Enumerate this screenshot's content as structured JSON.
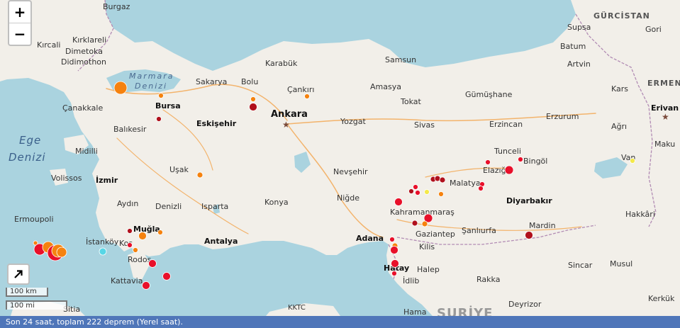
{
  "map": {
    "zoom_in_label": "+",
    "zoom_out_label": "−",
    "scale_km": "100 km",
    "scale_mi": "100 mi",
    "status_text": "Son 24 saat, toplam 222 deprem (Yerel saat).",
    "colors": {
      "sea": "#aad3df",
      "land": "#f2efe9",
      "quake_red": "#e8102a",
      "quake_darkred": "#b0101c",
      "quake_orange": "#f5820f",
      "quake_yellow": "#f4e94a",
      "quake_cyan": "#58d6e6",
      "status_bar": "#4f76b9"
    },
    "labels": {
      "burgaz": "Burgaz",
      "gurcistan": "GÜRCİSTAN",
      "kirklareli": "Kırklareli",
      "kircali": "Kırcali",
      "dimetoka": "Dimetoka",
      "didimothon": "Didimothon",
      "marmara": "Marmara",
      "denizi_m": "Denizi",
      "sakarya": "Sakarya",
      "bolu": "Bolu",
      "karabuk": "Karabük",
      "samsun": "Samsun",
      "supsa": "Supsa",
      "gori": "Gori",
      "batum": "Batum",
      "artvin": "Artvin",
      "kars": "Kars",
      "ermenistan": "ERMENİS",
      "canakkale": "Çanakkale",
      "bursa": "Bursa",
      "cankiri": "Çankırı",
      "amasya": "Amasya",
      "gumushane": "Gümüşhane",
      "tokat": "Tokat",
      "erzurum": "Erzurum",
      "erivan": "Erivan",
      "ege": "Ege",
      "denizi_e": "Denizi",
      "balikesir": "Balıkesir",
      "eskisehir": "Eskişehir",
      "ankara": "Ankara",
      "yozgat": "Yozgat",
      "sivas": "Sivas",
      "erzincan": "Erzincan",
      "agri": "Ağrı",
      "midilli": "Midilli",
      "tunceli": "Tunceli",
      "bingol": "Bingöl",
      "maku": "Maku",
      "usak": "Uşak",
      "nevsehir": "Nevşehir",
      "elazig": "Elazığ",
      "volissos": "Volissos",
      "izmir": "İzmir",
      "malatya": "Malatya",
      "van": "Van",
      "nigde": "Niğde",
      "aydin": "Aydın",
      "denizli": "Denizli",
      "isparta": "Isparta",
      "konya": "Konya",
      "diyarbakir": "Diyarbakır",
      "kahramanmaras": "Kahramanmaraş",
      "hakkari": "Hakkâri",
      "ermoupoli": "Ermoupoli",
      "mugla": "Muğla",
      "mardin": "Mardin",
      "gaziantep": "Gaziantep",
      "sanliurfa": "Şanlıurfa",
      "istankoy": "İstanköy",
      "kos": "Kos",
      "antalya": "Antalya",
      "adana": "Adana",
      "kilis": "Kilis",
      "rodos": "Rodos",
      "sincar": "Sincar",
      "musul": "Musul",
      "hatay": "Hatay",
      "halep": "Halep",
      "idlib": "İdlib",
      "rakka": "Rakka",
      "kattavia": "Kattavia",
      "deyrizor": "Deyrizor",
      "kerkuk": "Kerkük",
      "kktc": "KKTC",
      "sitia": "Sitia",
      "hama": "Hama",
      "suriye": "SURİYE"
    }
  }
}
